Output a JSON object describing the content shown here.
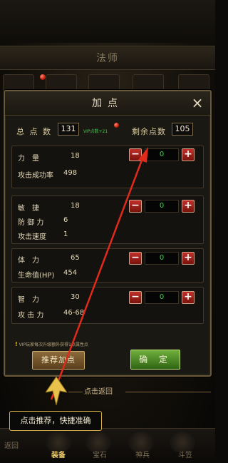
{
  "background": {
    "class_title": "法师"
  },
  "dialog": {
    "title": "加点",
    "close_icon": "×",
    "total_points_label": "总 点 数",
    "total_points": "131",
    "vip_bonus": "VIP点数+21",
    "remaining_label": "剩余点数",
    "remaining_points": "105"
  },
  "attributes": [
    {
      "name": "力　量",
      "value": "18",
      "sub": [
        {
          "label": "攻击成功率",
          "value": "498"
        }
      ],
      "allocated": "0"
    },
    {
      "name": "敏　捷",
      "value": "18",
      "sub": [
        {
          "label": "防 御 力",
          "value": "6"
        },
        {
          "label": "攻击速度",
          "value": "1"
        }
      ],
      "allocated": "0"
    },
    {
      "name": "体　力",
      "value": "65",
      "sub": [
        {
          "label": "生命值(HP)",
          "value": "454"
        }
      ],
      "allocated": "0"
    },
    {
      "name": "智　力",
      "value": "30",
      "sub": [
        {
          "label": "攻 击 力",
          "value": "46-68"
        }
      ],
      "allocated": "0"
    }
  ],
  "stepper": {
    "minus": "−",
    "plus": "+"
  },
  "tip": "VIP玩家每次升级额外获得1点属性点",
  "buttons": {
    "recommend": "推荐加点",
    "confirm": "确 定"
  },
  "click_return": "点击返回",
  "tooltip": "点击推荐，快捷准确",
  "nav": {
    "return": "返回",
    "items": [
      "装备",
      "宝石",
      "神兵",
      "斗笠"
    ],
    "active_index": 0
  },
  "colors": {
    "accent_gold": "#d8b04a",
    "confirm_green": "#4f8a26",
    "minus_plus_red": "#a0201a",
    "value_green": "#3fd34a",
    "arrow_red": "#e02a1c"
  }
}
